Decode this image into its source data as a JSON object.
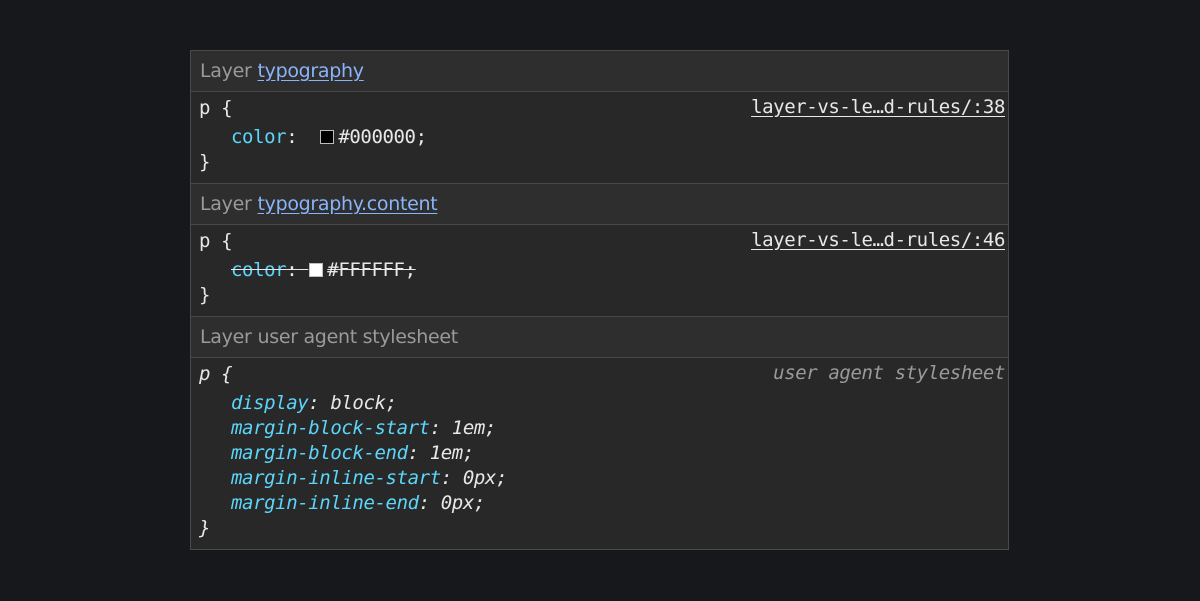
{
  "colors": {
    "background": "#17181c",
    "panel": "#282828",
    "header": "#2e2e2f",
    "link": "#8ab4f8",
    "property": "#5cd5fb"
  },
  "layers": [
    {
      "label": "Layer",
      "name": "typography",
      "selector": "p {",
      "close": "}",
      "source": "layer-vs-le…d-rules/:38",
      "declaration": {
        "property": "color",
        "colon": ":",
        "swatch_color": "#000000",
        "value": "#000000",
        "semicolon": ";",
        "overridden": false
      }
    },
    {
      "label": "Layer",
      "name": "typography.content",
      "selector": "p {",
      "close": "}",
      "source": "layer-vs-le…d-rules/:46",
      "declaration": {
        "property": "color",
        "colon": ":",
        "swatch_color": "#FFFFFF",
        "value": "#FFFFFF",
        "semicolon": ";",
        "overridden": true
      }
    }
  ],
  "user_agent_layer": {
    "label": "Layer",
    "name": "user agent stylesheet",
    "selector": "p {",
    "close": "}",
    "source": "user agent stylesheet",
    "declarations": [
      {
        "property": "display",
        "value": "block"
      },
      {
        "property": "margin-block-start",
        "value": "1em"
      },
      {
        "property": "margin-block-end",
        "value": "1em"
      },
      {
        "property": "margin-inline-start",
        "value": "0px"
      },
      {
        "property": "margin-inline-end",
        "value": "0px"
      }
    ]
  }
}
